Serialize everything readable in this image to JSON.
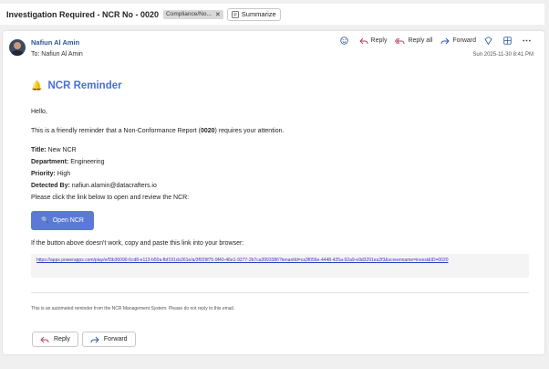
{
  "subject": {
    "title": "Investigation Required - NCR No - 0020",
    "tag_label": "Compliance/No...",
    "tag_close": "✕",
    "summarize_label": "Summarize"
  },
  "header": {
    "sender_name": "Nafiun Al Amin",
    "to_prefix": "To:",
    "to_name": "Nafiun Al Amin",
    "date": "Sun 2025-11-30 8:41 PM",
    "reply_label": "Reply",
    "reply_all_label": "Reply all",
    "forward_label": "Forward"
  },
  "body": {
    "heading": "NCR Reminder",
    "bell": "🔔",
    "greeting": "Hello,",
    "intro_before": "This is a friendly reminder that a Non-Conformance Report (",
    "intro_number": "0020",
    "intro_after": ") requires your attention.",
    "fields": [
      {
        "label": "Title:",
        "value": "New NCR"
      },
      {
        "label": "Department:",
        "value": "Engineering"
      },
      {
        "label": "Priority:",
        "value": "High"
      },
      {
        "label": "Detected By:",
        "value": "nafiun.alamin@datacrafters.io"
      }
    ],
    "click_text": "Please click the link below to open and review the NCR:",
    "open_button": "Open NCR",
    "open_icon": "🔍",
    "fallback_text": "If the button above doesn't work, copy and paste this link into your browser:",
    "link": "https://apps.powerapps.com/play/e/f3b36090-6cd8-e113-b50a-fbf191cb261e/a/3f929f75-9f40-46e1-9277-2b7ca3993386?tenantId=ca3f056e-4448-425a-92a9-e9d3291ea2f3&screenname=invest&ID=0020",
    "footer": "This is an automated reminder from the NCR Management System. Please do not reply to this email."
  },
  "bottom": {
    "reply_label": "Reply",
    "forward_label": "Forward"
  }
}
